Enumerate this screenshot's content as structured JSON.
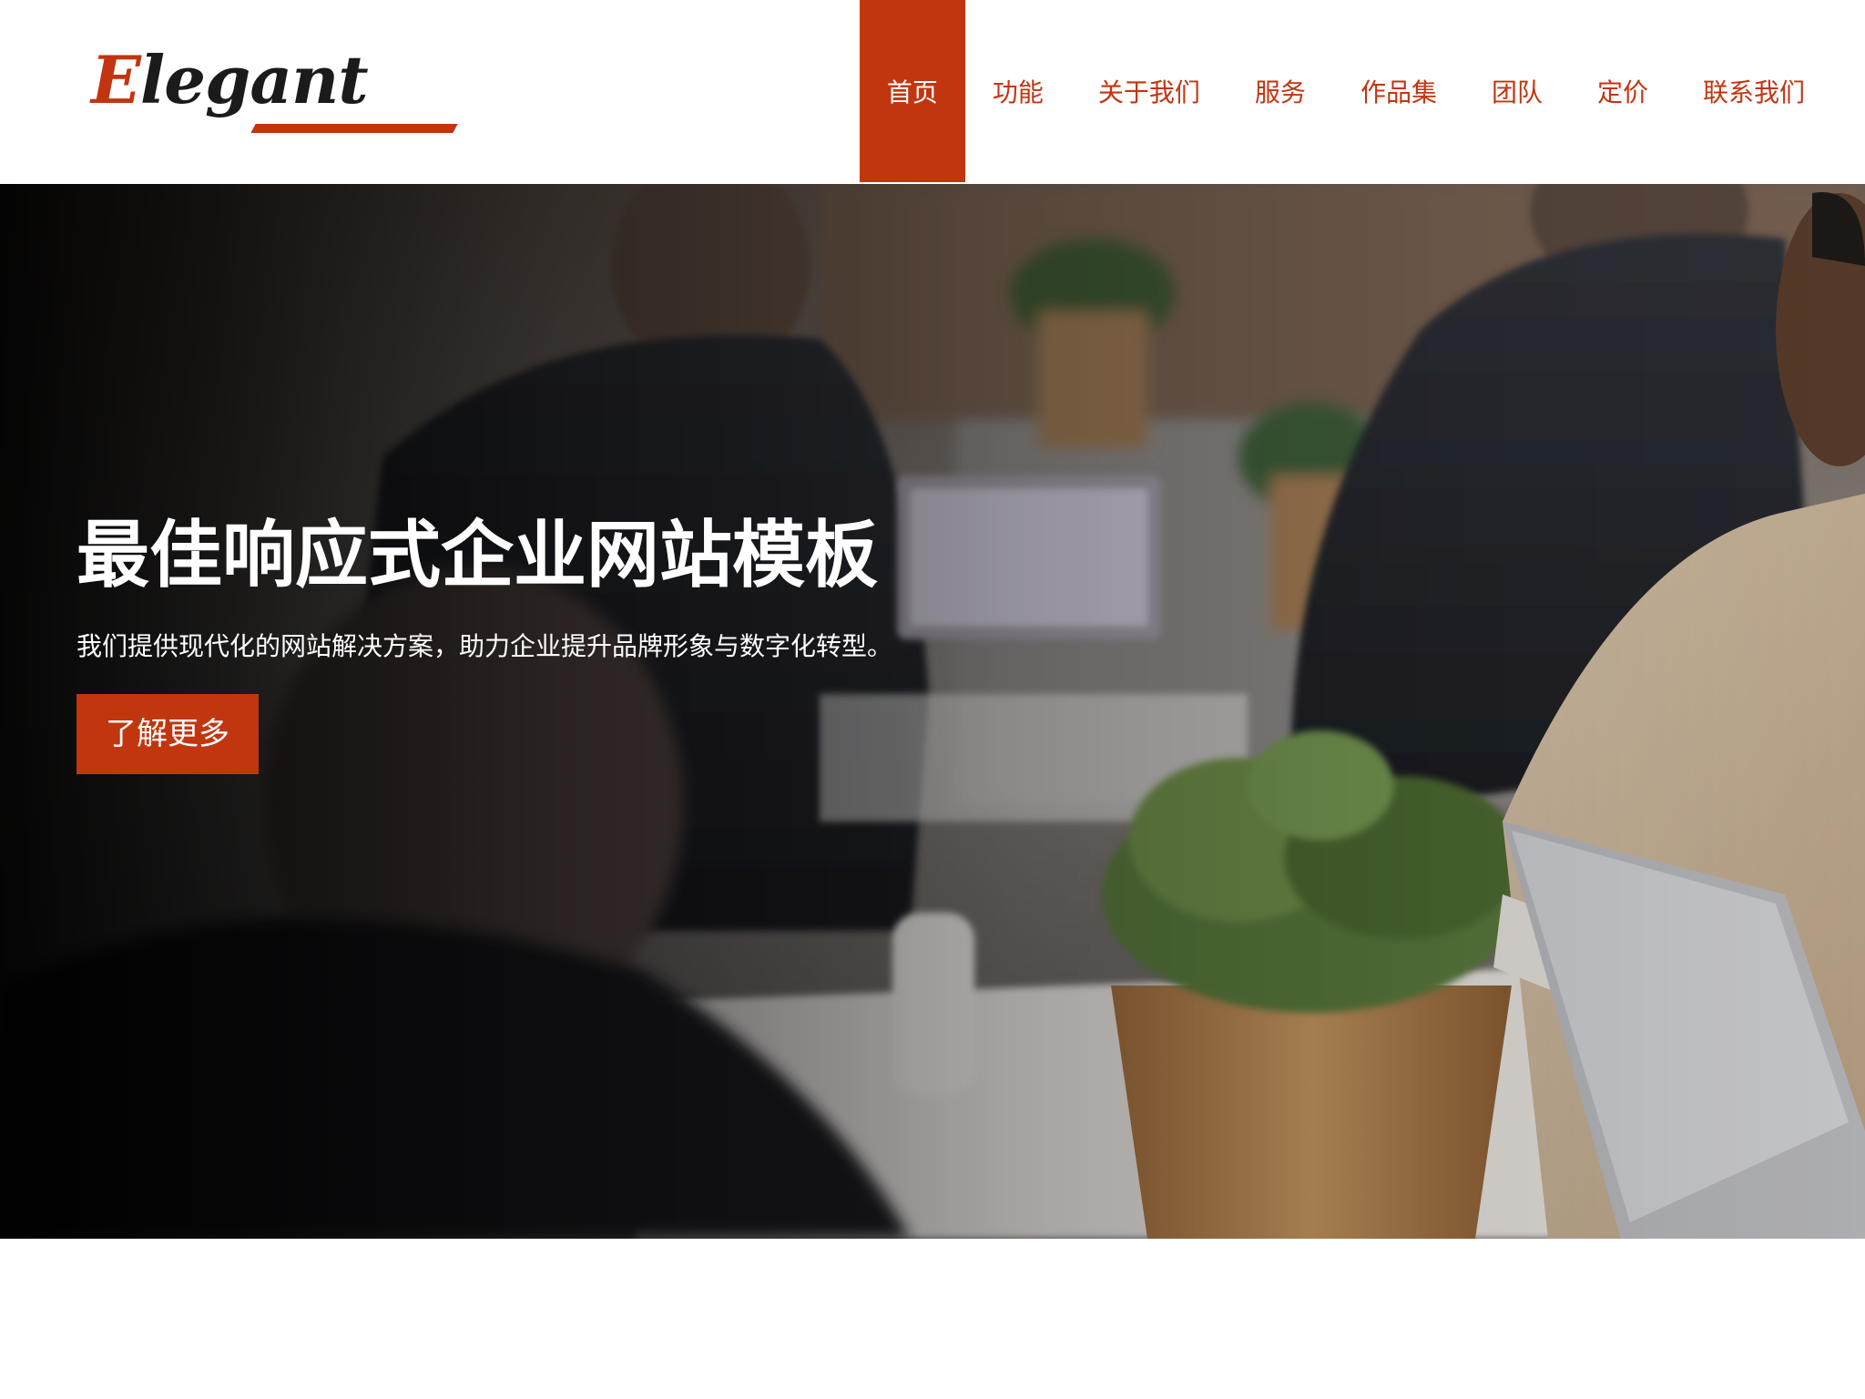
{
  "brand": {
    "logo_first_letter": "E",
    "logo_rest": "legant",
    "accent_color": "#c2360f"
  },
  "nav": {
    "items": [
      {
        "label": "首页",
        "active": true
      },
      {
        "label": "功能"
      },
      {
        "label": "关于我们"
      },
      {
        "label": "服务"
      },
      {
        "label": "作品集"
      },
      {
        "label": "团队"
      },
      {
        "label": "定价"
      },
      {
        "label": "联系我们"
      }
    ]
  },
  "hero": {
    "title": "最佳响应式企业网站模板",
    "subtitle": "我们提供现代化的网站解决方案，助力企业提升品牌形象与数字化转型。",
    "button_label": "了解更多"
  }
}
